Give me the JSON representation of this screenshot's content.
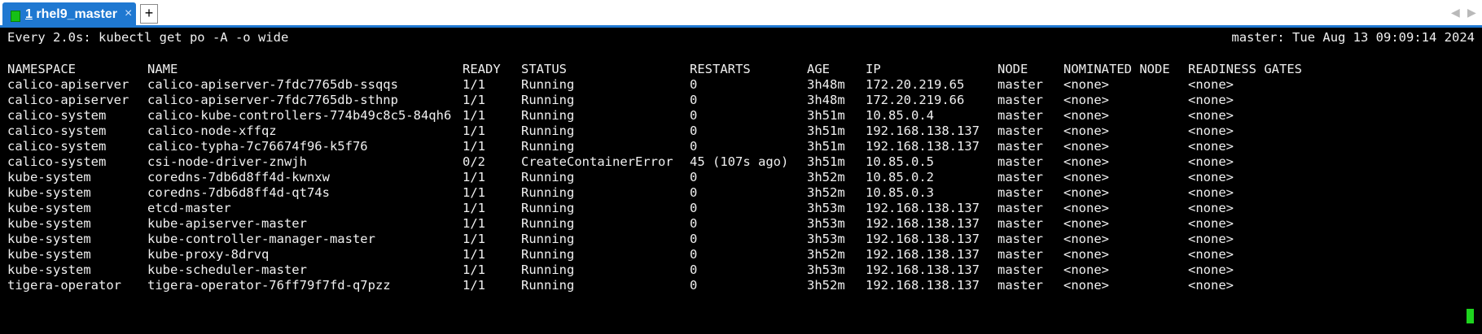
{
  "tab": {
    "number": "1",
    "title": "rhel9_master",
    "close_glyph": "×",
    "status_color": "#16c016"
  },
  "tabbar": {
    "add_label": "+",
    "nav_left": "◀",
    "nav_right": "▶",
    "accent": "#1f78d1"
  },
  "terminal": {
    "watch_command": "Every 2.0s: kubectl get po -A -o wide",
    "watch_status": "master: Tue Aug 13 09:09:14 2024",
    "columns": [
      "NAMESPACE",
      "NAME",
      "READY",
      "STATUS",
      "RESTARTS",
      "AGE",
      "IP",
      "NODE",
      "NOMINATED NODE",
      "READINESS GATES"
    ],
    "rows": [
      [
        "calico-apiserver",
        "calico-apiserver-7fdc7765db-ssqqs",
        "1/1",
        "Running",
        "0",
        "3h48m",
        "172.20.219.65",
        "master",
        "<none>",
        "<none>"
      ],
      [
        "calico-apiserver",
        "calico-apiserver-7fdc7765db-sthnp",
        "1/1",
        "Running",
        "0",
        "3h48m",
        "172.20.219.66",
        "master",
        "<none>",
        "<none>"
      ],
      [
        "calico-system",
        "calico-kube-controllers-774b49c8c5-84qh6",
        "1/1",
        "Running",
        "0",
        "3h51m",
        "10.85.0.4",
        "master",
        "<none>",
        "<none>"
      ],
      [
        "calico-system",
        "calico-node-xffqz",
        "1/1",
        "Running",
        "0",
        "3h51m",
        "192.168.138.137",
        "master",
        "<none>",
        "<none>"
      ],
      [
        "calico-system",
        "calico-typha-7c76674f96-k5f76",
        "1/1",
        "Running",
        "0",
        "3h51m",
        "192.168.138.137",
        "master",
        "<none>",
        "<none>"
      ],
      [
        "calico-system",
        "csi-node-driver-znwjh",
        "0/2",
        "CreateContainerError",
        "45 (107s ago)",
        "3h51m",
        "10.85.0.5",
        "master",
        "<none>",
        "<none>"
      ],
      [
        "kube-system",
        "coredns-7db6d8ff4d-kwnxw",
        "1/1",
        "Running",
        "0",
        "3h52m",
        "10.85.0.2",
        "master",
        "<none>",
        "<none>"
      ],
      [
        "kube-system",
        "coredns-7db6d8ff4d-qt74s",
        "1/1",
        "Running",
        "0",
        "3h52m",
        "10.85.0.3",
        "master",
        "<none>",
        "<none>"
      ],
      [
        "kube-system",
        "etcd-master",
        "1/1",
        "Running",
        "0",
        "3h53m",
        "192.168.138.137",
        "master",
        "<none>",
        "<none>"
      ],
      [
        "kube-system",
        "kube-apiserver-master",
        "1/1",
        "Running",
        "0",
        "3h53m",
        "192.168.138.137",
        "master",
        "<none>",
        "<none>"
      ],
      [
        "kube-system",
        "kube-controller-manager-master",
        "1/1",
        "Running",
        "0",
        "3h53m",
        "192.168.138.137",
        "master",
        "<none>",
        "<none>"
      ],
      [
        "kube-system",
        "kube-proxy-8drvq",
        "1/1",
        "Running",
        "0",
        "3h52m",
        "192.168.138.137",
        "master",
        "<none>",
        "<none>"
      ],
      [
        "kube-system",
        "kube-scheduler-master",
        "1/1",
        "Running",
        "0",
        "3h53m",
        "192.168.138.137",
        "master",
        "<none>",
        "<none>"
      ],
      [
        "tigera-operator",
        "tigera-operator-76ff79f7fd-q7pzz",
        "1/1",
        "Running",
        "0",
        "3h52m",
        "192.168.138.137",
        "master",
        "<none>",
        "<none>"
      ]
    ]
  }
}
